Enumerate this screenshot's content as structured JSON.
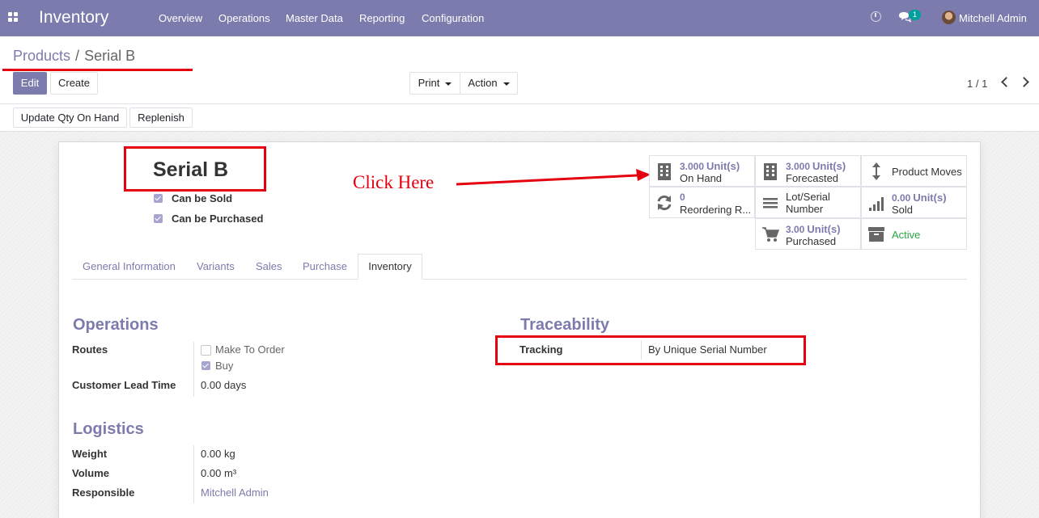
{
  "navbar": {
    "brand": "Inventory",
    "menu": [
      "Overview",
      "Operations",
      "Master Data",
      "Reporting",
      "Configuration"
    ],
    "chat_badge": "1",
    "user": "Mitchell Admin",
    "apps_icon": "grid-icon",
    "activity_icon": "clock-icon",
    "messaging_icon": "chat-icon"
  },
  "breadcrumb": {
    "parent": "Products",
    "separator": "/",
    "current": "Serial B"
  },
  "toolbar": {
    "edit": "Edit",
    "create": "Create",
    "print": "Print",
    "action": "Action",
    "pager": "1 / 1",
    "update_qty": "Update Qty On Hand",
    "replenish": "Replenish"
  },
  "product": {
    "name": "Serial B",
    "can_be_sold": "Can be Sold",
    "can_be_purchased": "Can be Purchased"
  },
  "smart_buttons": {
    "on_hand": {
      "value": "3.000",
      "unit": "Unit(s)",
      "label": "On Hand",
      "icon": "building-icon"
    },
    "forecasted": {
      "value": "3.000",
      "unit": "Unit(s)",
      "label": "Forecasted",
      "icon": "building-icon"
    },
    "product_moves": {
      "label": "Product Moves",
      "icon": "up-down-arrow-icon"
    },
    "reordering": {
      "value": "0",
      "label": "Reordering R...",
      "icon": "refresh-icon"
    },
    "lot_serial": {
      "label_line1": "Lot/Serial",
      "label_line2": "Number",
      "icon": "list-icon"
    },
    "sold": {
      "value": "0.00",
      "unit": "Unit(s)",
      "label": "Sold",
      "icon": "signal-bars-icon"
    },
    "purchased": {
      "value": "3.00",
      "unit": "Unit(s)",
      "label": "Purchased",
      "icon": "cart-icon"
    },
    "active": {
      "label": "Active",
      "icon": "archive-icon",
      "color": "#28a745"
    }
  },
  "tabs": [
    "General Information",
    "Variants",
    "Sales",
    "Purchase",
    "Inventory"
  ],
  "operations": {
    "title": "Operations",
    "routes_label": "Routes",
    "route_make_to_order": "Make To Order",
    "route_buy": "Buy",
    "lead_time_label": "Customer Lead Time",
    "lead_time_value": "0.00 days"
  },
  "traceability": {
    "title": "Traceability",
    "tracking_label": "Tracking",
    "tracking_value": "By Unique Serial Number"
  },
  "logistics": {
    "title": "Logistics",
    "weight_label": "Weight",
    "weight_value": "0.00",
    "weight_unit": "kg",
    "volume_label": "Volume",
    "volume_value": "0.00",
    "volume_unit": "m³",
    "responsible_label": "Responsible",
    "responsible_value": "Mitchell Admin"
  },
  "annotation": {
    "text": "Click Here",
    "color": "#e4000f"
  },
  "colors": {
    "brand": "#7c7bad",
    "active": "#28a745",
    "annotation": "#e4000f"
  }
}
